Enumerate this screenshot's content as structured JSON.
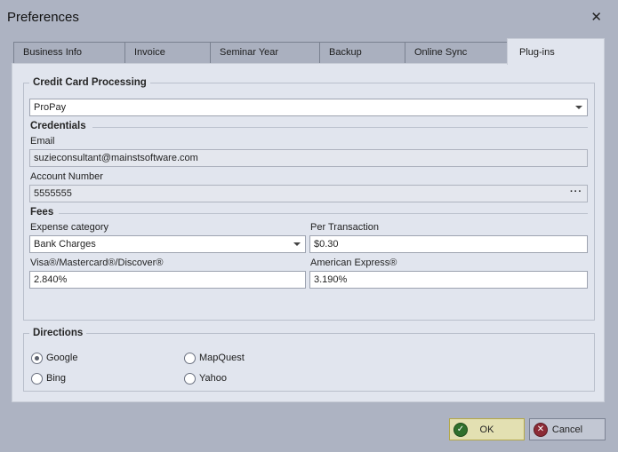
{
  "window": {
    "title": "Preferences"
  },
  "tabs": [
    {
      "label": "Business Info"
    },
    {
      "label": "Invoice"
    },
    {
      "label": "Seminar Year"
    },
    {
      "label": "Backup"
    },
    {
      "label": "Online Sync"
    },
    {
      "label": "Plug-ins",
      "active": true
    }
  ],
  "credit_card": {
    "legend": "Credit Card Processing",
    "processor": "ProPay",
    "credentials_heading": "Credentials",
    "email_label": "Email",
    "email_value": "suzieconsultant@mainstsoftware.com",
    "account_label": "Account Number",
    "account_value": "5555555",
    "fees_heading": "Fees",
    "expense_label": "Expense category",
    "expense_value": "Bank Charges",
    "per_transaction_label": "Per Transaction",
    "per_transaction_value": "$0.30",
    "visa_label": "Visa®/Mastercard®/Discover®",
    "visa_value": "2.840%",
    "amex_label": "American Express®",
    "amex_value": "3.190%"
  },
  "directions": {
    "legend": "Directions",
    "options": [
      {
        "label": "Google",
        "selected": true
      },
      {
        "label": "MapQuest",
        "selected": false
      },
      {
        "label": "Bing",
        "selected": false
      },
      {
        "label": "Yahoo",
        "selected": false
      }
    ]
  },
  "buttons": {
    "ok": "OK",
    "cancel": "Cancel"
  },
  "icons": {
    "close": "close-icon",
    "ok": "check-icon",
    "cancel": "cancel-icon"
  }
}
